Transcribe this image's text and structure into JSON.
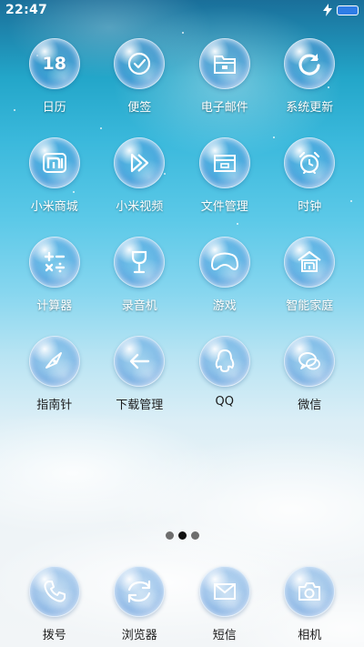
{
  "status_bar": {
    "time": "22:47"
  },
  "home": {
    "rows": [
      [
        {
          "label": "日历",
          "icon": "calendar-icon",
          "text": "18"
        },
        {
          "label": "便签",
          "icon": "notes-check-icon"
        },
        {
          "label": "电子邮件",
          "icon": "mail-folder-icon"
        },
        {
          "label": "系统更新",
          "icon": "refresh-icon"
        }
      ],
      [
        {
          "label": "小米商城",
          "icon": "mi-store-icon"
        },
        {
          "label": "小米视频",
          "icon": "video-play-icon"
        },
        {
          "label": "文件管理",
          "icon": "file-manager-icon"
        },
        {
          "label": "时钟",
          "icon": "alarm-clock-icon"
        }
      ],
      [
        {
          "label": "计算器",
          "icon": "calculator-icon"
        },
        {
          "label": "录音机",
          "icon": "recorder-goblet-icon"
        },
        {
          "label": "游戏",
          "icon": "gamepad-icon"
        },
        {
          "label": "智能家庭",
          "icon": "smart-home-icon"
        }
      ],
      [
        {
          "label": "指南针",
          "icon": "compass-icon"
        },
        {
          "label": "下载管理",
          "icon": "download-arrow-icon"
        },
        {
          "label": "QQ",
          "icon": "qq-penguin-icon"
        },
        {
          "label": "微信",
          "icon": "wechat-icon"
        }
      ]
    ],
    "page_indicator": {
      "count": 3,
      "active_index": 1
    }
  },
  "dock": [
    {
      "label": "拨号",
      "icon": "phone-dial-icon"
    },
    {
      "label": "浏览器",
      "icon": "browser-sync-icon"
    },
    {
      "label": "短信",
      "icon": "message-envelope-icon"
    },
    {
      "label": "相机",
      "icon": "camera-icon"
    }
  ]
}
